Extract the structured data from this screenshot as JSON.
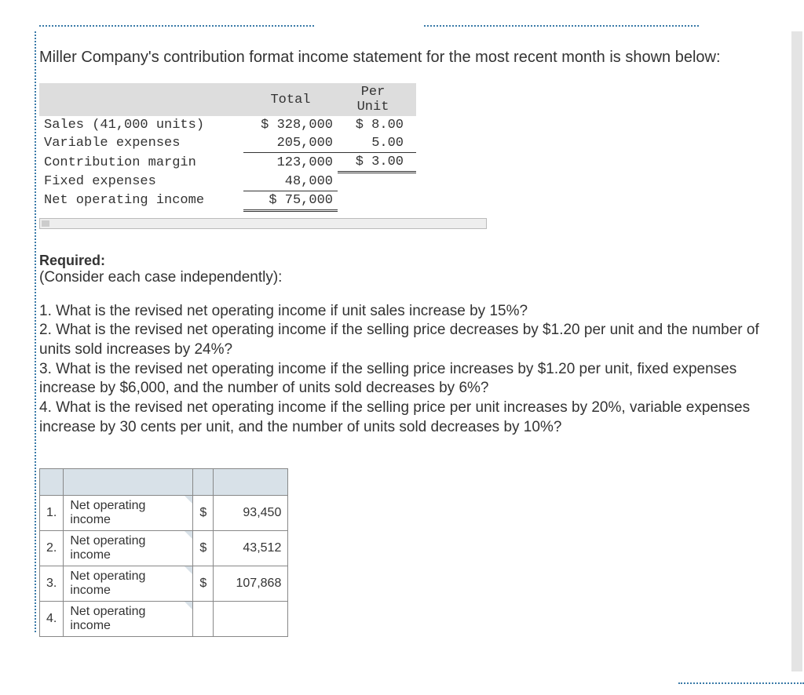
{
  "intro": "Miller Company's contribution format income statement for the most recent month is shown below:",
  "income_statement": {
    "headers": {
      "total": "Total",
      "per_unit": "Per Unit"
    },
    "rows": {
      "sales": {
        "label": "Sales (41,000 units)",
        "total": "$ 328,000",
        "per_unit": "$ 8.00"
      },
      "variable": {
        "label": "Variable expenses",
        "total": "205,000",
        "per_unit": "5.00"
      },
      "contribution": {
        "label": "Contribution margin",
        "total": "123,000",
        "per_unit": "$ 3.00"
      },
      "fixed": {
        "label": "Fixed expenses",
        "total": "48,000",
        "per_unit": ""
      },
      "noi": {
        "label": "Net operating income",
        "total": "$  75,000",
        "per_unit": ""
      }
    }
  },
  "required_label": "Required:",
  "consider": "(Consider each case independently):",
  "questions": {
    "q1": "1. What is the revised net operating income if unit sales increase by 15%?",
    "q2": "2. What is the revised net operating income if the selling price decreases by $1.20 per unit and the number of units sold increases by 24%?",
    "q3": "3. What is the revised net operating income if the selling price increases by $1.20 per unit, fixed expenses increase by $6,000, and the number of units sold decreases by 6%?",
    "q4": "4. What is the revised net operating income if the selling price per unit increases by 20%, variable expenses increase by 30 cents per unit, and the number of units sold decreases by 10%?"
  },
  "answers": {
    "row_label": "Net operating income",
    "rows": [
      {
        "num": "1.",
        "currency": "$",
        "value": "93,450"
      },
      {
        "num": "2.",
        "currency": "$",
        "value": "43,512"
      },
      {
        "num": "3.",
        "currency": "$",
        "value": "107,868"
      },
      {
        "num": "4.",
        "currency": "",
        "value": ""
      }
    ]
  }
}
